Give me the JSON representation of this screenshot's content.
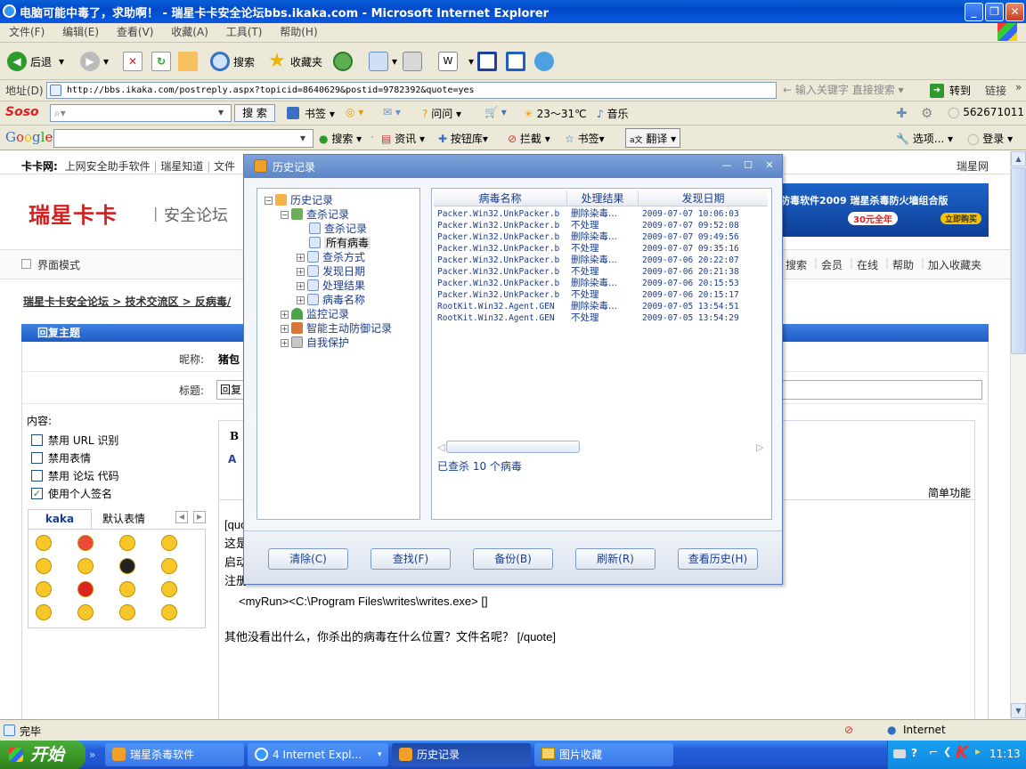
{
  "window": {
    "title": "电脑可能中毒了，求助啊！ - 瑞星卡卡安全论坛bbs.ikaka.com - Microsoft Internet Explorer"
  },
  "menu": [
    "文件(F)",
    "编辑(E)",
    "查看(V)",
    "收藏(A)",
    "工具(T)",
    "帮助(H)"
  ],
  "toolbar": {
    "back": "后退",
    "search": "搜索",
    "favorites": "收藏夹"
  },
  "address": {
    "label": "地址(D)",
    "url": "http://bbs.ikaka.com/postreply.aspx?topicid=8640629&postid=9782392&quote=yes",
    "hint": "输入关键字 直接搜索",
    "go": "转到",
    "links": "链接"
  },
  "soso": {
    "search_btn": "搜 索",
    "bookmark": "书签",
    "ask": "问问",
    "weather": "23～31℃",
    "music": "音乐",
    "qq": "562671011"
  },
  "google": {
    "search": "搜索",
    "news": "资讯",
    "buttons": "按钮库",
    "block": "拦截",
    "bookmark": "书签",
    "translate": "翻译",
    "options": "选项...",
    "login": "登录"
  },
  "site": {
    "topnav": [
      "卡卡网:",
      "上网安全助手软件",
      "瑞星知道",
      "文件"
    ],
    "topright": "瑞星网",
    "logo": "瑞星卡卡",
    "logo_sub": "安全论坛",
    "ad_text": "防毒软件2009 瑞星杀毒防火墙组合版",
    "ad_price": "30元全年",
    "ad_button": "立即购买",
    "mode": "界面模式",
    "nav_right": [
      "搜索",
      "会员",
      "在线",
      "帮助",
      "加入收藏夹"
    ],
    "breadcrumb": [
      "瑞星卡卡安全论坛",
      "技术交流区",
      "反病毒/"
    ],
    "reply_header": "回复主题",
    "nick_label": "昵称:",
    "nick_value": "猪包",
    "title_label": "标题:",
    "title_value": "回复",
    "content_label": "内容:",
    "checks": [
      {
        "label": "禁用 URL 识别",
        "checked": false
      },
      {
        "label": "禁用表情",
        "checked": false
      },
      {
        "label": "禁用 论坛 代码",
        "checked": false
      },
      {
        "label": "使用个人签名",
        "checked": true
      }
    ],
    "emoticon_tabs": [
      "kaka",
      "默认表情"
    ],
    "pages": [
      "1",
      "2"
    ],
    "simple_mode": "简单功能",
    "editor_lines": [
      "[quo",
      "这是",
      "启动",
      "注册"
    ],
    "editor_run": "<myRun><C:\\Program Files\\writes\\writes.exe>  []",
    "editor_question": "其他没看出什么，你杀出的病毒在什么位置？文件名呢？  [/quote]"
  },
  "dialog": {
    "title": "历史记录",
    "tree": [
      {
        "label": "历史记录",
        "level": 0
      },
      {
        "label": "查杀记录",
        "level": 1
      },
      {
        "label": "查杀记录",
        "level": 2
      },
      {
        "label": "所有病毒",
        "level": 2,
        "selected": true
      },
      {
        "label": "查杀方式",
        "level": 2
      },
      {
        "label": "发现日期",
        "level": 2
      },
      {
        "label": "处理结果",
        "level": 2
      },
      {
        "label": "病毒名称",
        "level": 2
      },
      {
        "label": "监控记录",
        "level": 1
      },
      {
        "label": "智能主动防御记录",
        "level": 1
      },
      {
        "label": "自我保护",
        "level": 1
      }
    ],
    "columns": [
      "病毒名称",
      "处理结果",
      "发现日期"
    ],
    "rows": [
      [
        "Packer.Win32.UnkPacker.b",
        "删除染毒...",
        "2009-07-07 10:06:03"
      ],
      [
        "Packer.Win32.UnkPacker.b",
        "不处理",
        "2009-07-07 09:52:08"
      ],
      [
        "Packer.Win32.UnkPacker.b",
        "删除染毒...",
        "2009-07-07 09:49:56"
      ],
      [
        "Packer.Win32.UnkPacker.b",
        "不处理",
        "2009-07-07 09:35:16"
      ],
      [
        "Packer.Win32.UnkPacker.b",
        "删除染毒...",
        "2009-07-06 20:22:07"
      ],
      [
        "Packer.Win32.UnkPacker.b",
        "不处理",
        "2009-07-06 20:21:38"
      ],
      [
        "Packer.Win32.UnkPacker.b",
        "删除染毒...",
        "2009-07-06 20:15:53"
      ],
      [
        "Packer.Win32.UnkPacker.b",
        "不处理",
        "2009-07-06 20:15:17"
      ],
      [
        "RootKit.Win32.Agent.GEN",
        "删除染毒...",
        "2009-07-05 13:54:51"
      ],
      [
        "RootKit.Win32.Agent.GEN",
        "不处理",
        "2009-07-05 13:54:29"
      ]
    ],
    "summary": "已查杀 10 个病毒",
    "buttons": [
      "清除(C)",
      "查找(F)",
      "备份(B)",
      "刷新(R)",
      "查看历史(H)"
    ]
  },
  "status": {
    "text": "完毕",
    "zone": "Internet"
  },
  "taskbar": {
    "start": "开始",
    "tasks": [
      "瑞星杀毒软件",
      "4 Internet Expl...",
      "历史记录",
      "图片收藏"
    ],
    "clock": "11:13"
  }
}
